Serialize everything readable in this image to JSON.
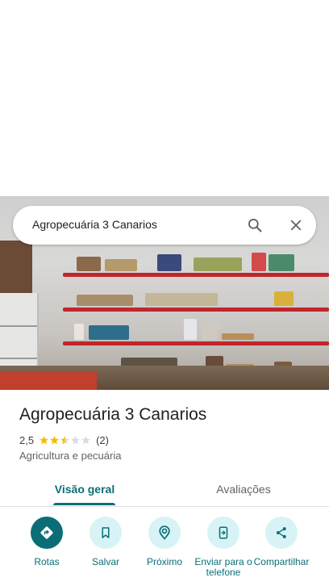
{
  "search": {
    "query": "Agropecuária 3 Canarios"
  },
  "place": {
    "name": "Agropecuária 3 Canarios",
    "rating_value": "2,5",
    "rating_stars": 2.5,
    "rating_count": "(2)",
    "category": "Agricultura e pecuária"
  },
  "tabs": [
    {
      "label": "Visão geral",
      "active": true
    },
    {
      "label": "Avaliações",
      "active": false
    }
  ],
  "actions": [
    {
      "label": "Rotas",
      "icon": "directions-icon"
    },
    {
      "label": "Salvar",
      "icon": "bookmark-icon"
    },
    {
      "label": "Próximo",
      "icon": "nearby-icon"
    },
    {
      "label": "Enviar para o telefone",
      "icon": "send-to-phone-icon"
    },
    {
      "label": "Compartilhar",
      "icon": "share-icon"
    }
  ],
  "colors": {
    "accent": "#0b6e77",
    "action_bg": "#d7f3f6",
    "star": "#fbbc04",
    "star_empty": "#dadce0"
  }
}
